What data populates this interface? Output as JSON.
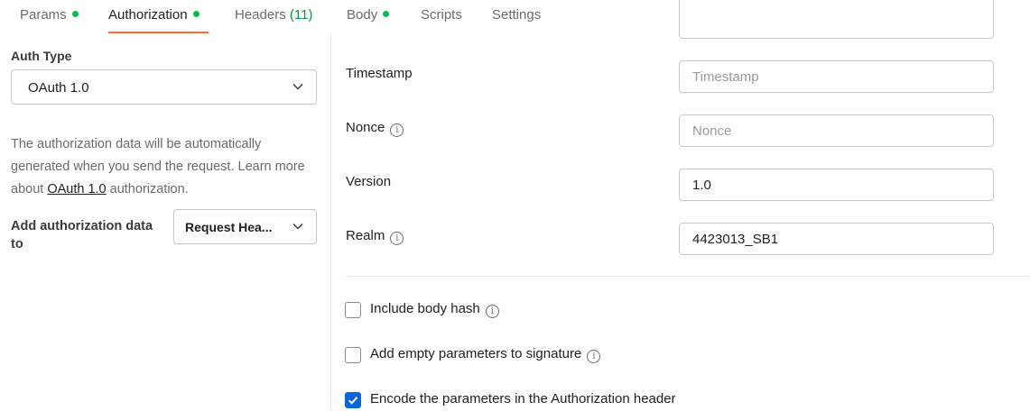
{
  "tabs": [
    {
      "label": "Params",
      "indicator": true
    },
    {
      "label": "Authorization",
      "indicator": true,
      "active": true
    },
    {
      "label": "Headers",
      "count": "(11)"
    },
    {
      "label": "Body",
      "indicator": true
    },
    {
      "label": "Scripts"
    },
    {
      "label": "Settings"
    }
  ],
  "left": {
    "auth_type_label": "Auth Type",
    "auth_type_value": "OAuth 1.0",
    "info_before_link": "The authorization data will be automatically generated when you send the request. Learn more about ",
    "info_link": "OAuth 1.0",
    "info_after_link": " authorization.",
    "add_auth_label": "Add authorization data to",
    "add_auth_value": "Request Hea..."
  },
  "fields": [
    {
      "label": "Timestamp",
      "value": "",
      "placeholder": "Timestamp",
      "info": false
    },
    {
      "label": "Nonce",
      "value": "",
      "placeholder": "Nonce",
      "info": true
    },
    {
      "label": "Version",
      "value": "1.0",
      "placeholder": "",
      "info": false
    },
    {
      "label": "Realm",
      "value": "4423013_SB1",
      "placeholder": "",
      "info": true
    }
  ],
  "checkboxes": [
    {
      "label": "Include body hash",
      "checked": false,
      "info": true
    },
    {
      "label": "Add empty parameters to signature",
      "checked": false,
      "info": true
    },
    {
      "label": "Encode the parameters in the Authorization header",
      "checked": true,
      "info": false
    }
  ],
  "icons": {
    "info": "info-icon",
    "chevron": "chevron-down-icon",
    "check": "checkmark-icon"
  },
  "colors": {
    "accent": "#ff6c37",
    "status_dot": "#0cbb52",
    "checkbox": "#0b65d8"
  }
}
